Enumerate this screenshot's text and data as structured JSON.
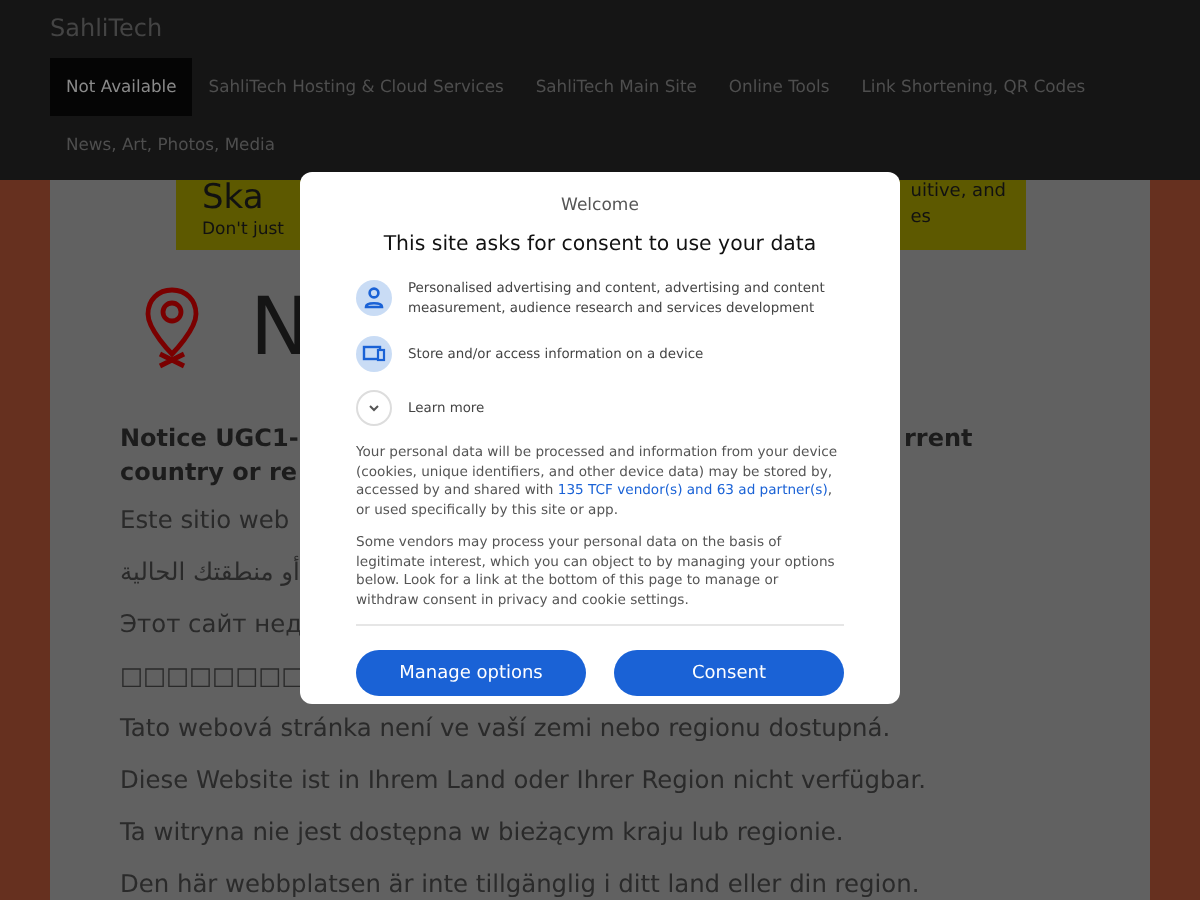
{
  "site_title": "SahliTech",
  "nav": [
    {
      "label": "Not Available",
      "selected": true
    },
    {
      "label": "SahliTech Hosting & Cloud Services",
      "selected": false
    },
    {
      "label": "SahliTech Main Site",
      "selected": false
    },
    {
      "label": "Online Tools",
      "selected": false
    },
    {
      "label": "Link Shortening, QR Codes",
      "selected": false
    },
    {
      "label": "News, Art, Photos, Media",
      "selected": false
    }
  ],
  "banner": {
    "title": "Ska",
    "tagline": "Don't just",
    "right_lines": [
      "uitive, and",
      "es"
    ]
  },
  "page_heading": "N",
  "notice": {
    "left_lines": [
      "Notice UGC1-",
      "country or re"
    ],
    "right_line": "rrent"
  },
  "messages": [
    "Este sitio web",
    "أو منطقتك الحالية",
    "Этот сайт нед",
    "□□□□□□□□",
    "Tato webová stránka není ve vaší zemi nebo regionu dostupná.",
    "Diese Website ist in Ihrem Land oder Ihrer Region nicht verfügbar.",
    "Ta witryna nie jest dostępna w bieżącym kraju lub regionie.",
    "Den här webbplatsen är inte tillgänglig i ditt land eller din region."
  ],
  "consent": {
    "welcome": "Welcome",
    "title": "This site asks for consent to use your data",
    "purposes": [
      {
        "kind": "person",
        "text": "Personalised advertising and content, advertising and content measurement, audience research and services development"
      },
      {
        "kind": "device",
        "text": "Store and/or access information on a device"
      },
      {
        "kind": "expand",
        "text": "Learn more"
      }
    ],
    "paragraph_1_before": "Your personal data will be processed and information from your device (cookies, unique identifiers, and other device data) may be stored by, accessed by and shared with",
    "vendors_link": "135 TCF vendor(s) and 63 ad partner(s)",
    "paragraph_1_after": ", or used specifically by this site or app.",
    "paragraph_2": "Some vendors may process your personal data on the basis of legitimate interest, which you can object to by managing your options below. Look for a link at the bottom of this page to manage or withdraw consent in privacy and cookie settings.",
    "buttons": [
      "Manage options",
      "Consent"
    ]
  }
}
